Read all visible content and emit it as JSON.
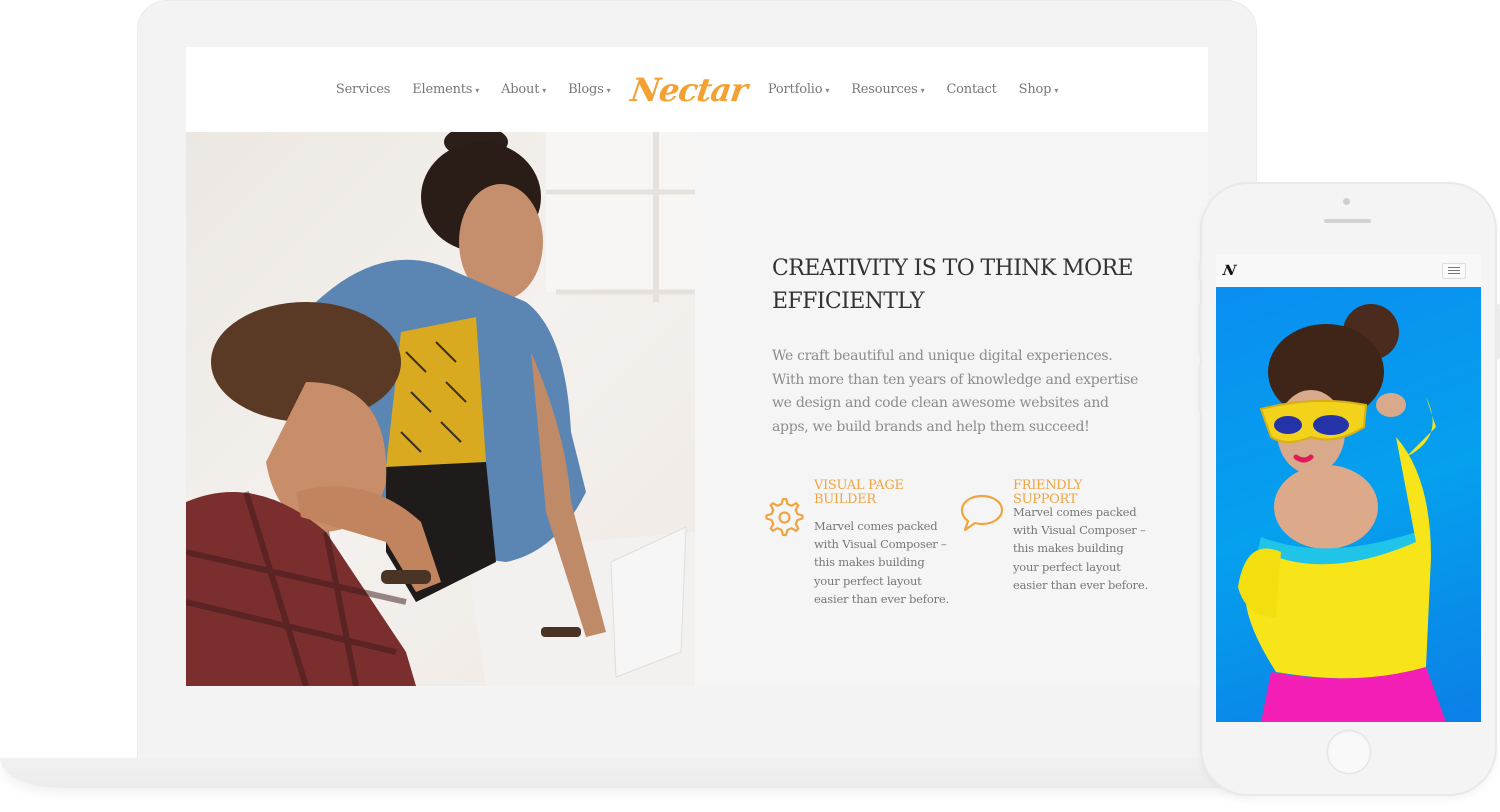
{
  "desktop": {
    "nav": {
      "left_items": [
        {
          "label": "Services",
          "has_dropdown": false
        },
        {
          "label": "Elements",
          "has_dropdown": true
        },
        {
          "label": "About",
          "has_dropdown": true
        },
        {
          "label": "Blogs",
          "has_dropdown": true
        }
      ],
      "logo": "Nectar",
      "right_items": [
        {
          "label": "Portfolio",
          "has_dropdown": true
        },
        {
          "label": "Resources",
          "has_dropdown": true
        },
        {
          "label": "Contact",
          "has_dropdown": false
        },
        {
          "label": "Shop",
          "has_dropdown": true
        }
      ],
      "dropdown_glyph": "⌄"
    },
    "hero": {
      "photo_description": "Two people looking at papers at a desk in a bright office",
      "headline_line1": "CREATIVITY IS TO THINK MORE",
      "headline_line2": "EFFICIENTLY",
      "intro": "We craft beautiful and unique digital experiences. With more than ten years of knowledge and expertise we design and code clean awesome websites and apps, we build brands and help them succeed!"
    },
    "features": [
      {
        "icon": "gear-icon",
        "title_line1": "VISUAL PAGE",
        "title_line2": "BUILDER",
        "text": "Marvel comes packed with Visual Composer – this makes building your perfect layout easier than ever before."
      },
      {
        "icon": "speech-bubble-icon",
        "title_line1": "FRIENDLY SUPPORT",
        "title_line2": "",
        "text": "Marvel comes packed with Visual Composer – this makes building your perfect layout easier than ever before."
      }
    ]
  },
  "mobile": {
    "logo": "N",
    "menu_icon": "hamburger-icon",
    "photo_description": "Woman in yellow sunglasses and yellow top against blue background"
  },
  "colors": {
    "accent": "#f4a032",
    "heading": "#333333",
    "body_text": "#8c8c8c",
    "nav_text": "#777777",
    "mobile_bg": "#0a8ef0"
  }
}
